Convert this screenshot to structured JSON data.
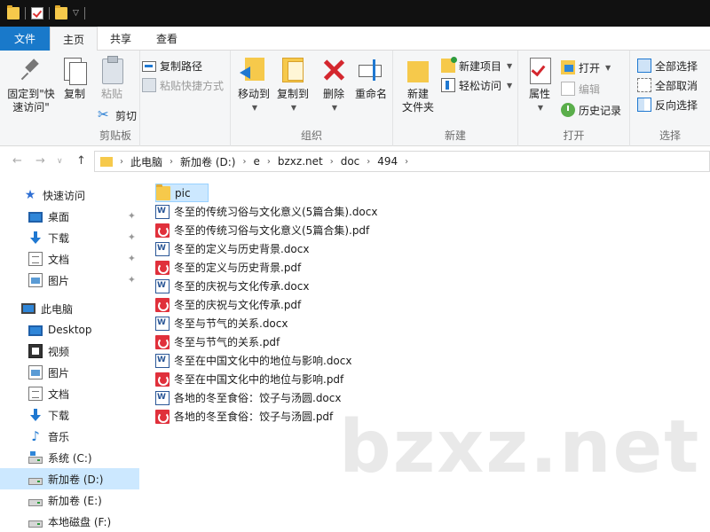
{
  "ribbon_tabs": {
    "file": "文件",
    "home": "主页",
    "share": "共享",
    "view": "查看"
  },
  "ribbon": {
    "clipboard": {
      "label": "剪贴板",
      "pin_line1": "固定到\"快",
      "pin_line2": "速访问\"",
      "copy": "复制",
      "paste": "粘贴",
      "copy_path": "复制路径",
      "paste_shortcut": "粘贴快捷方式",
      "cut": "剪切"
    },
    "organize": {
      "label": "组织",
      "move_to": "移动到",
      "copy_to": "复制到",
      "delete": "删除",
      "rename": "重命名"
    },
    "new": {
      "label": "新建",
      "new_folder_line1": "新建",
      "new_folder_line2": "文件夹",
      "new_item": "新建项目",
      "easy_access": "轻松访问"
    },
    "open": {
      "label": "打开",
      "properties": "属性",
      "open": "打开",
      "edit": "编辑",
      "history": "历史记录"
    },
    "select": {
      "label": "选择",
      "select_all": "全部选择",
      "select_none": "全部取消",
      "invert": "反向选择"
    }
  },
  "breadcrumb": [
    "此电脑",
    "新加卷 (D:)",
    "e",
    "bzxz.net",
    "doc",
    "494"
  ],
  "nav": {
    "quick_access": "快速访问",
    "pinned": [
      "桌面",
      "下载",
      "文档",
      "图片"
    ],
    "this_pc": "此电脑",
    "pc_items": [
      "Desktop",
      "视频",
      "图片",
      "文档",
      "下载",
      "音乐"
    ],
    "drives": [
      "系统 (C:)",
      "新加卷 (D:)",
      "新加卷 (E:)",
      "本地磁盘 (F:)"
    ]
  },
  "files": [
    {
      "name": "pic",
      "type": "folder"
    },
    {
      "name": "冬至的传统习俗与文化意义(5篇合集).docx",
      "type": "docx"
    },
    {
      "name": "冬至的传统习俗与文化意义(5篇合集).pdf",
      "type": "pdf"
    },
    {
      "name": "冬至的定义与历史背景.docx",
      "type": "docx"
    },
    {
      "name": "冬至的定义与历史背景.pdf",
      "type": "pdf"
    },
    {
      "name": "冬至的庆祝与文化传承.docx",
      "type": "docx"
    },
    {
      "name": "冬至的庆祝与文化传承.pdf",
      "type": "pdf"
    },
    {
      "name": "冬至与节气的关系.docx",
      "type": "docx"
    },
    {
      "name": "冬至与节气的关系.pdf",
      "type": "pdf"
    },
    {
      "name": "冬至在中国文化中的地位与影响.docx",
      "type": "docx"
    },
    {
      "name": "冬至在中国文化中的地位与影响.pdf",
      "type": "pdf"
    },
    {
      "name": "各地的冬至食俗：饺子与汤圆.docx",
      "type": "docx"
    },
    {
      "name": "各地的冬至食俗：饺子与汤圆.pdf",
      "type": "pdf"
    }
  ],
  "watermark": "bzxz.net",
  "colors": {
    "accent": "#1979ca",
    "selection": "#cce8ff",
    "folder": "#f6c94b",
    "pdf": "#e0303b",
    "word": "#2b5797"
  }
}
